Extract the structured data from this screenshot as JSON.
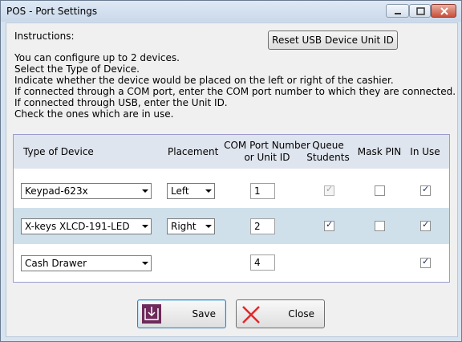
{
  "window": {
    "title": "POS - Port Settings"
  },
  "instructions": {
    "heading": "Instructions:",
    "lines": [
      "You can configure up to 2 devices.",
      "Select the Type of Device.",
      "Indicate whether the device would be placed on the left or right of the cashier.",
      "If connected through a COM port, enter the COM port number to which they are connected.",
      "If connected through USB, enter the Unit ID.",
      "Check the ones which are in use."
    ]
  },
  "reset_button": "Reset USB Device Unit ID",
  "grid": {
    "headers": {
      "type": "Type of Device",
      "placement": "Placement",
      "com_port_1": "COM Port Number",
      "com_port_2": "or Unit ID",
      "queue_1": "Queue",
      "queue_2": "Students",
      "mask_pin": "Mask PIN",
      "in_use": "In Use"
    },
    "rows": [
      {
        "device": "Keypad-623x",
        "placement": "Left",
        "port": "1",
        "queue_students": true,
        "queue_enabled": false,
        "mask_pin": false,
        "mask_enabled": false,
        "in_use": true
      },
      {
        "device": "X-keys XLCD-191-LED",
        "placement": "Right",
        "port": "2",
        "queue_students": true,
        "queue_enabled": true,
        "mask_pin": false,
        "mask_enabled": true,
        "in_use": true
      },
      {
        "device": "Cash Drawer",
        "placement": "",
        "port": "4",
        "in_use": true
      }
    ]
  },
  "buttons": {
    "save": "Save",
    "close": "Close"
  },
  "icons": {
    "save": "save-arrow-icon",
    "close": "close-x-icon"
  },
  "colors": {
    "save_icon_bg": "#6d2a5a",
    "close_icon_color": "#e0282a",
    "alt_row": "#cfe0ea"
  }
}
